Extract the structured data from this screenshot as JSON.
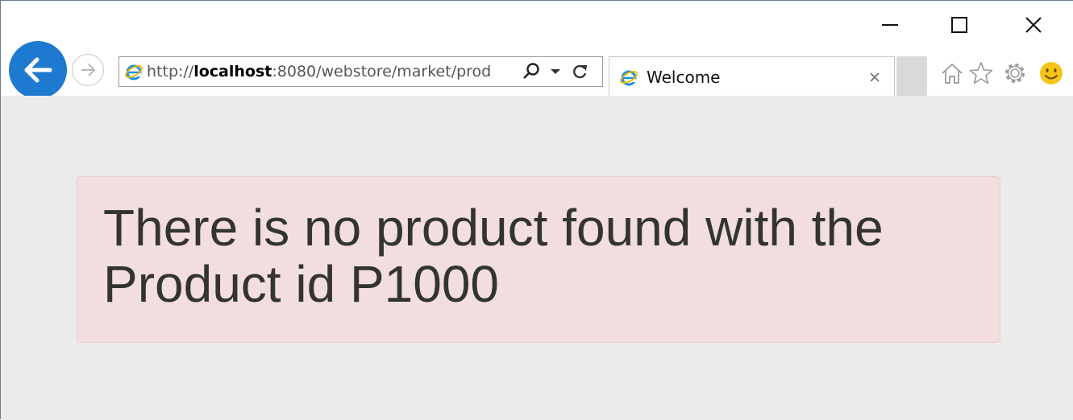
{
  "browser": {
    "address": {
      "url_prefix": "http://",
      "url_host": "localhost",
      "url_rest": ":8080/webstore/market/prod"
    },
    "tab": {
      "title": "Welcome"
    },
    "window_controls": {
      "minimize_icon": "minimize-icon",
      "maximize_icon": "maximize-icon",
      "close_icon": "close-icon"
    },
    "toolbar_icons": [
      "home-icon",
      "star-icon",
      "gear-icon",
      "smiley-icon"
    ]
  },
  "page": {
    "alert_message": "There is no product found with the Product id P1000"
  },
  "colors": {
    "back_button": "#1e7ad0",
    "alert_background": "#f2dede",
    "page_background": "#ebebeb",
    "smiley": "#f5c518"
  }
}
